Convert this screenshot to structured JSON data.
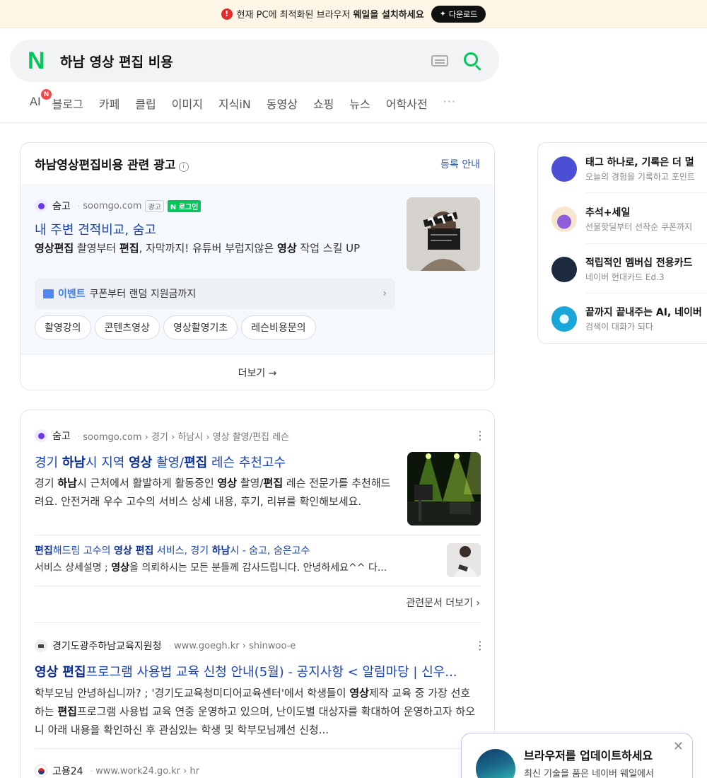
{
  "banner": {
    "message": "현재 PC에 최적화된 브라우저",
    "highlight": "웨일을 설치하세요",
    "download_label": "다운로드",
    "alert_glyph": "!"
  },
  "search": {
    "logo": "N",
    "query": "하남 영상 편집 비용"
  },
  "tabs": [
    {
      "label": "AI",
      "badge": "N"
    },
    {
      "label": "블로그"
    },
    {
      "label": "카페"
    },
    {
      "label": "클립"
    },
    {
      "label": "이미지"
    },
    {
      "label": "지식iN"
    },
    {
      "label": "동영상"
    },
    {
      "label": "쇼핑"
    },
    {
      "label": "뉴스"
    },
    {
      "label": "어학사전"
    },
    {
      "label": "···"
    }
  ],
  "ad": {
    "title": "하남영상편집비용 관련 광고",
    "info_glyph": "i",
    "register": "등록 안내",
    "site_name": "숨고",
    "site_url": "soomgo.com",
    "ad_tag": "광고",
    "login_tag": "N 로그인",
    "headline": "내 주변 견적비교, 숨고",
    "desc_b1": "영상편집",
    "desc_t1": " 촬영부터 ",
    "desc_b2": "편집",
    "desc_t2": ", 자막까지! 유튜버 부럽지않은 ",
    "desc_b3": "영상",
    "desc_t3": " 작업 스킬 UP",
    "event_label": "이벤트",
    "event_text": "쿠폰부터 랜덤 지원금까지",
    "chips": [
      "촬영강의",
      "콘텐츠영상",
      "영상촬영기초",
      "레슨비용문의"
    ],
    "more": "더보기 →"
  },
  "result1": {
    "site_name": "숨고",
    "breadcrumb": "soomgo.com › 경기 › 하남시 › 영상 촬영/편집 레슨",
    "title_p1": "경기 ",
    "title_b1": "하남",
    "title_p2": "시 지역 ",
    "title_b2": "영상",
    "title_p3": " 촬영/",
    "title_b3": "편집",
    "title_p4": " 레슨 추천고수",
    "desc_p1": "경기 ",
    "desc_b1": "하남",
    "desc_p2": "시 근처에서 활발하게 활동중인 ",
    "desc_b2": "영상",
    "desc_p3": " 촬영/",
    "desc_b3": "편집",
    "desc_p4": " 레슨 전문가를 추천해드려요. 안전거래 우수 고수의 서비스 상세 내용, 후기, 리뷰를 확인해보세요.",
    "sub_b1": "편집",
    "sub_p1": "해드림 고수의 ",
    "sub_b2": "영상 편집",
    "sub_p2": " 서비스, 경기 ",
    "sub_b3": "하남",
    "sub_p3": "시 - 숨고, 숨은고수",
    "subdesc_p1": "서비스 상세설명 ; ",
    "subdesc_b1": "영상",
    "subdesc_p2": "을 의뢰하시는 모든 분들께 감사드립니다. 안녕하세요^^ 다...",
    "related": "관련문서 더보기 ›"
  },
  "result2": {
    "site_name": "경기도광주하남교육지원청",
    "breadcrumb": "www.goegh.kr › shinwoo-e",
    "title_b1": "영상 편집",
    "title_p1": "프로그램 사용법 교육 신청 안내(5월) - 공지사항 < 알림마당 | 신우...",
    "desc_p1": "학부모님 안녕하십니까? ; '경기도교육청미디어교육센터'에서 학생들이 ",
    "desc_b1": "영상",
    "desc_p2": "제작 교육 중 가장 선호하는 ",
    "desc_b2": "편집",
    "desc_p3": "프로그램 사용법 교육 연중 운영하고 있으며, 난이도별 대상자를 확대하여 운영하고자 하오니 아래 내용을 확인하신 후 관심있는 학생 및 학부모님께선 신청..."
  },
  "result3": {
    "site_name": "고용24",
    "breadcrumb": "www.work24.go.kr › hr"
  },
  "kebab": "⋮",
  "right_panel": [
    {
      "title": "태그 하나로, 기록은 더 멀",
      "sub": "오늘의 경험을 기록하고 포인트",
      "icon_color": "#4b4fd6"
    },
    {
      "title": "추석+세일",
      "sub": "선물핫딜부터 선착순 쿠폰까지",
      "icon_color": "#f3e3c8"
    },
    {
      "title": "적립적인 멤버십 전용카드",
      "sub": "네이버 현대카드 Ed.3",
      "icon_color": "#1e2b3e"
    },
    {
      "title": "끝까지 끝내주는 AI, 네이버",
      "sub": "검색이 대화가 되다",
      "icon_color": "#1aa6d9"
    }
  ],
  "popup": {
    "title": "브라우저를 업데이트하세요",
    "desc": "최신 기술을 품은 네이버 웨일에서",
    "close": "✕"
  },
  "colors": {
    "naver_green": "#03c75a",
    "link_blue": "#1a44b8",
    "banner_bg": "#fdf6e6"
  }
}
